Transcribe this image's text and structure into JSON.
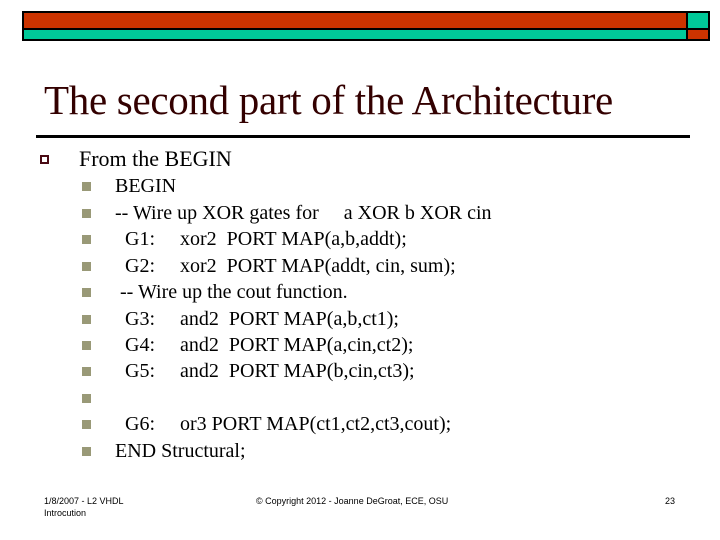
{
  "header": {
    "colors": {
      "primary_bar": "#cc3300",
      "secondary_bar": "#00c999",
      "title": "#330000",
      "sub_bullet": "#999977"
    }
  },
  "slide": {
    "title": "The second part of the Architecture",
    "bullet": {
      "icon": "hollow-square-bullet-icon",
      "text": "From the BEGIN",
      "sub_items": [
        {
          "icon": "filled-square-bullet-icon",
          "text": "BEGIN"
        },
        {
          "icon": "filled-square-bullet-icon",
          "text": "-- Wire up XOR gates for     a XOR b XOR cin"
        },
        {
          "icon": "filled-square-bullet-icon",
          "text": "  G1:     xor2  PORT MAP(a,b,addt);"
        },
        {
          "icon": "filled-square-bullet-icon",
          "text": "  G2:     xor2  PORT MAP(addt, cin, sum);"
        },
        {
          "icon": "filled-square-bullet-icon",
          "text": " -- Wire up the cout function."
        },
        {
          "icon": "filled-square-bullet-icon",
          "text": "  G3:     and2  PORT MAP(a,b,ct1);"
        },
        {
          "icon": "filled-square-bullet-icon",
          "text": "  G4:     and2  PORT MAP(a,cin,ct2);"
        },
        {
          "icon": "filled-square-bullet-icon",
          "text": "  G5:     and2  PORT MAP(b,cin,ct3);"
        },
        {
          "icon": "filled-square-bullet-icon",
          "text": ""
        },
        {
          "icon": "filled-square-bullet-icon",
          "text": "  G6:     or3 PORT MAP(ct1,ct2,ct3,cout);"
        },
        {
          "icon": "filled-square-bullet-icon",
          "text": "END Structural;"
        }
      ]
    }
  },
  "footer": {
    "left_line1": "1/8/2007 - L2 VHDL",
    "left_line2": "Introcution",
    "center": "© Copyright 2012 - Joanne DeGroat, ECE, OSU",
    "page_number": "23"
  }
}
